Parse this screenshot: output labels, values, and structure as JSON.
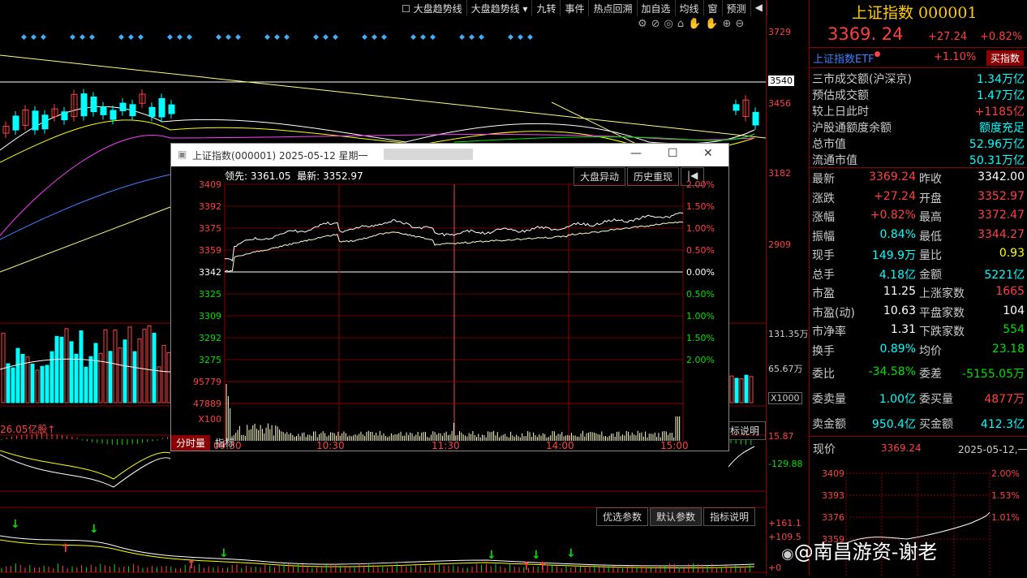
{
  "toolbar": {
    "trend_checkbox": "大盘趋势线",
    "trend_select": "大盘趋势线",
    "items": [
      "九转",
      "事件",
      "热点回溯",
      "加自选",
      "均线",
      "窗",
      "预测"
    ]
  },
  "price_axis": [
    "3729",
    "3540",
    "3456",
    "3182",
    "2909"
  ],
  "volume_axis": [
    "131.35万",
    "65.67万",
    "X1000"
  ],
  "indicator_axis": [
    "15.87",
    "-129.88"
  ],
  "bottom_axis": [
    "+161.1",
    "+109.5",
    "+0"
  ],
  "volume_label": "26.05亿股↑",
  "mid_buttons": [
    "分时量",
    "指标"
  ],
  "indicator_buttons": [
    "指标说明"
  ],
  "bottom_buttons": [
    "优选参数",
    "默认参数",
    "指标说明"
  ],
  "popup": {
    "title": "上证指数(000001) 2025-05-12 星期一",
    "lead_label": "领先: 3361.05",
    "latest_label": "最新: 3352.97",
    "btn1": "大盘异动",
    "btn2": "历史重现",
    "y_left": [
      "3409",
      "3392",
      "3375",
      "3359",
      "3342",
      "3325",
      "3309",
      "3292",
      "3275"
    ],
    "y_right": [
      "2.00%",
      "1.50%",
      "1.00%",
      "0.50%",
      "0.00%",
      "0.50%",
      "1.00%",
      "1.50%",
      "2.00%"
    ],
    "vol_ticks": [
      "95779",
      "47889",
      "X100"
    ],
    "x_ticks": [
      "09:30",
      "10:30",
      "11:30",
      "14:00",
      "15:00"
    ],
    "tabs": [
      "分时量",
      "指标"
    ]
  },
  "quote": {
    "name": "上证指数 000001",
    "price": "3369. 24",
    "change": "+27.24",
    "pct": "+0.82%",
    "etf_label": "上证指数ETF",
    "etf_pct": "+1.10%",
    "buy_btn": "买指数",
    "stats": [
      {
        "k": "三市成交额(沪深京)",
        "v": "1.34万亿",
        "c": "cyan"
      },
      {
        "k": "预估成交额",
        "v": "1.47万亿",
        "c": "cyan"
      },
      {
        "k": "较上日此时",
        "v": "+1185亿",
        "c": "red"
      },
      {
        "k": "沪股通额度余额",
        "v": "额度充足",
        "c": "cyan"
      },
      {
        "k": "总市值",
        "v": "52.96万亿",
        "c": "cyan"
      },
      {
        "k": "流通市值",
        "v": "50.31万亿",
        "c": "cyan"
      }
    ],
    "grid": [
      [
        "最新",
        "3369.24",
        "red",
        "昨收",
        "3342.00",
        "white"
      ],
      [
        "涨跌",
        "+27.24",
        "red",
        "开盘",
        "3352.97",
        "red"
      ],
      [
        "涨幅",
        "+0.82%",
        "red",
        "最高",
        "3372.47",
        "red"
      ],
      [
        "振幅",
        "0.84%",
        "cyan",
        "最低",
        "3344.27",
        "red"
      ],
      [
        "现手",
        "149.9万",
        "cyan",
        "量比",
        "0.93",
        "yellow"
      ],
      [
        "总手",
        "4.18亿",
        "cyan",
        "金额",
        "5221亿",
        "cyan"
      ],
      [
        "市盈",
        "11.25",
        "white",
        "上涨家数",
        "1665",
        "red"
      ],
      [
        "市盈(动)",
        "10.63",
        "white",
        "平盘家数",
        "104",
        "white"
      ],
      [
        "市净率",
        "1.31",
        "white",
        "下跌家数",
        "554",
        "green"
      ],
      [
        "换手",
        "0.89%",
        "cyan",
        "均价",
        "23.18",
        "green"
      ]
    ],
    "order": [
      [
        "委比",
        "-34.58%",
        "green",
        "委差",
        "-5155.05万",
        "green"
      ],
      [
        "委卖量",
        "1.00亿",
        "cyan",
        "委买量",
        "4877万",
        "red"
      ],
      [
        "卖金额",
        "950.4亿",
        "cyan",
        "买金额",
        "412.3亿",
        "cyan"
      ]
    ],
    "now_label": "现价",
    "now_value": "3369.24",
    "now_date": "2025-05-12,一",
    "mini_y_left": [
      "3409",
      "3393",
      "3376",
      "3359"
    ],
    "mini_y_right": [
      "2.00%",
      "1.53%",
      "1.01%"
    ],
    "watermark": "@南昌游资-谢老"
  }
}
